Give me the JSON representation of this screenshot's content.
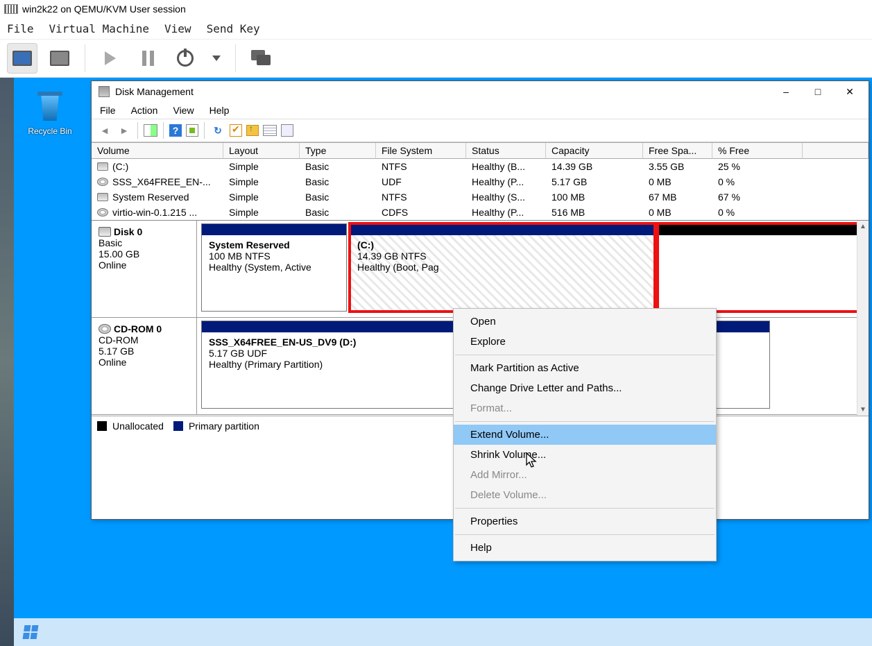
{
  "host": {
    "title": "win2k22 on QEMU/KVM User session",
    "menu": {
      "file": "File",
      "vm": "Virtual Machine",
      "view": "View",
      "sendkey": "Send Key"
    }
  },
  "desktop": {
    "recycle": "Recycle Bin"
  },
  "dm": {
    "title": "Disk Management",
    "menu": {
      "file": "File",
      "action": "Action",
      "view": "View",
      "help": "Help"
    },
    "columns": {
      "volume": "Volume",
      "layout": "Layout",
      "type": "Type",
      "fs": "File System",
      "status": "Status",
      "capacity": "Capacity",
      "free": "Free Spa...",
      "pct": "% Free"
    },
    "volumes": [
      {
        "icon": "hdd",
        "name": "(C:)",
        "layout": "Simple",
        "type": "Basic",
        "fs": "NTFS",
        "status": "Healthy (B...",
        "cap": "14.39 GB",
        "free": "3.55 GB",
        "pct": "25 %"
      },
      {
        "icon": "cd",
        "name": "SSS_X64FREE_EN-...",
        "layout": "Simple",
        "type": "Basic",
        "fs": "UDF",
        "status": "Healthy (P...",
        "cap": "5.17 GB",
        "free": "0 MB",
        "pct": "0 %"
      },
      {
        "icon": "hdd",
        "name": "System Reserved",
        "layout": "Simple",
        "type": "Basic",
        "fs": "NTFS",
        "status": "Healthy (S...",
        "cap": "100 MB",
        "free": "67 MB",
        "pct": "67 %"
      },
      {
        "icon": "cd",
        "name": "virtio-win-0.1.215 ...",
        "layout": "Simple",
        "type": "Basic",
        "fs": "CDFS",
        "status": "Healthy (P...",
        "cap": "516 MB",
        "free": "0 MB",
        "pct": "0 %"
      }
    ],
    "disk0": {
      "label": "Disk 0",
      "type": "Basic",
      "size": "15.00 GB",
      "state": "Online",
      "sysres": {
        "title": "System Reserved",
        "line1": "100 MB NTFS",
        "line2": "Healthy (System, Active"
      },
      "c": {
        "title": "(C:)",
        "line1": "14.39 GB NTFS",
        "line2": "Healthy (Boot, Pag"
      }
    },
    "cdrom0": {
      "label": "CD-ROM 0",
      "type": "CD-ROM",
      "size": "5.17 GB",
      "state": "Online",
      "part": {
        "title": "SSS_X64FREE_EN-US_DV9 (D:)",
        "line1": "5.17 GB UDF",
        "line2": "Healthy (Primary Partition)"
      }
    },
    "legend": {
      "unalloc": "Unallocated",
      "primary": "Primary partition"
    }
  },
  "ctx": {
    "open": "Open",
    "explore": "Explore",
    "mark_active": "Mark Partition as Active",
    "change_letter": "Change Drive Letter and Paths...",
    "format": "Format...",
    "extend": "Extend Volume...",
    "shrink": "Shrink Volume...",
    "add_mirror": "Add Mirror...",
    "delete_volume": "Delete Volume...",
    "properties": "Properties",
    "help": "Help"
  },
  "colors": {
    "primary_bar": "#001a7a",
    "unalloc_bar": "#000000",
    "highlight": "#90c8f6",
    "outline": "#e11010"
  }
}
